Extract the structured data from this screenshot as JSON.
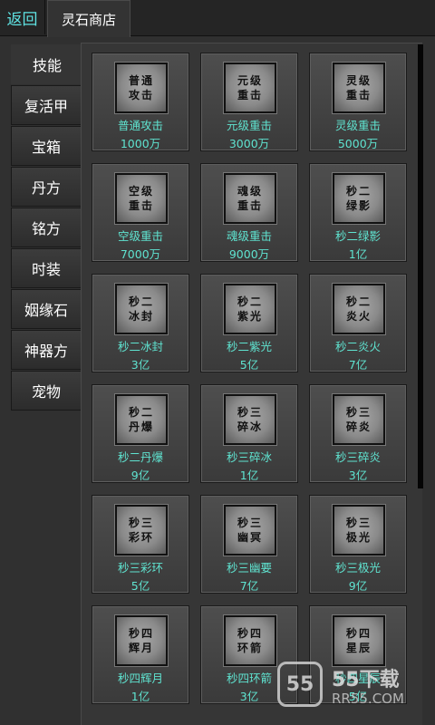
{
  "header": {
    "back_label": "返回",
    "tab_label": "灵石商店"
  },
  "sidebar": {
    "items": [
      {
        "label": "技能",
        "active": true
      },
      {
        "label": "复活甲"
      },
      {
        "label": "宝箱"
      },
      {
        "label": "丹方"
      },
      {
        "label": "铭方"
      },
      {
        "label": "时装"
      },
      {
        "label": "姻缘石"
      },
      {
        "label": "神器方"
      },
      {
        "label": "宠物"
      }
    ]
  },
  "items": [
    {
      "icon_text": "普通攻击",
      "name": "普通攻击",
      "price": "1000万"
    },
    {
      "icon_text": "元级重击",
      "name": "元级重击",
      "price": "3000万"
    },
    {
      "icon_text": "灵级重击",
      "name": "灵级重击",
      "price": "5000万"
    },
    {
      "icon_text": "空级重击",
      "name": "空级重击",
      "price": "7000万"
    },
    {
      "icon_text": "魂级重击",
      "name": "魂级重击",
      "price": "9000万"
    },
    {
      "icon_text": "秒二绿影",
      "name": "秒二绿影",
      "price": "1亿"
    },
    {
      "icon_text": "秒二冰封",
      "name": "秒二冰封",
      "price": "3亿"
    },
    {
      "icon_text": "秒二紫光",
      "name": "秒二紫光",
      "price": "5亿"
    },
    {
      "icon_text": "秒二炎火",
      "name": "秒二炎火",
      "price": "7亿"
    },
    {
      "icon_text": "秒二丹爆",
      "name": "秒二丹爆",
      "price": "9亿"
    },
    {
      "icon_text": "秒三碎冰",
      "name": "秒三碎冰",
      "price": "1亿"
    },
    {
      "icon_text": "秒三碎炎",
      "name": "秒三碎炎",
      "price": "3亿"
    },
    {
      "icon_text": "秒三彩环",
      "name": "秒三彩环",
      "price": "5亿"
    },
    {
      "icon_text": "秒三幽冥",
      "name": "秒三幽要",
      "price": "7亿"
    },
    {
      "icon_text": "秒三极光",
      "name": "秒三极光",
      "price": "9亿"
    },
    {
      "icon_text": "秒四辉月",
      "name": "秒四辉月",
      "price": "1亿"
    },
    {
      "icon_text": "秒四环箭",
      "name": "秒四环箭",
      "price": "3亿"
    },
    {
      "icon_text": "秒四星辰",
      "name": "秒四星辰",
      "price": "5亿"
    }
  ],
  "watermark": {
    "logo_text": "55",
    "title": "55下载",
    "url": "RR55.COM"
  },
  "colors": {
    "accent": "#5fe3d0",
    "background": "#303030"
  }
}
